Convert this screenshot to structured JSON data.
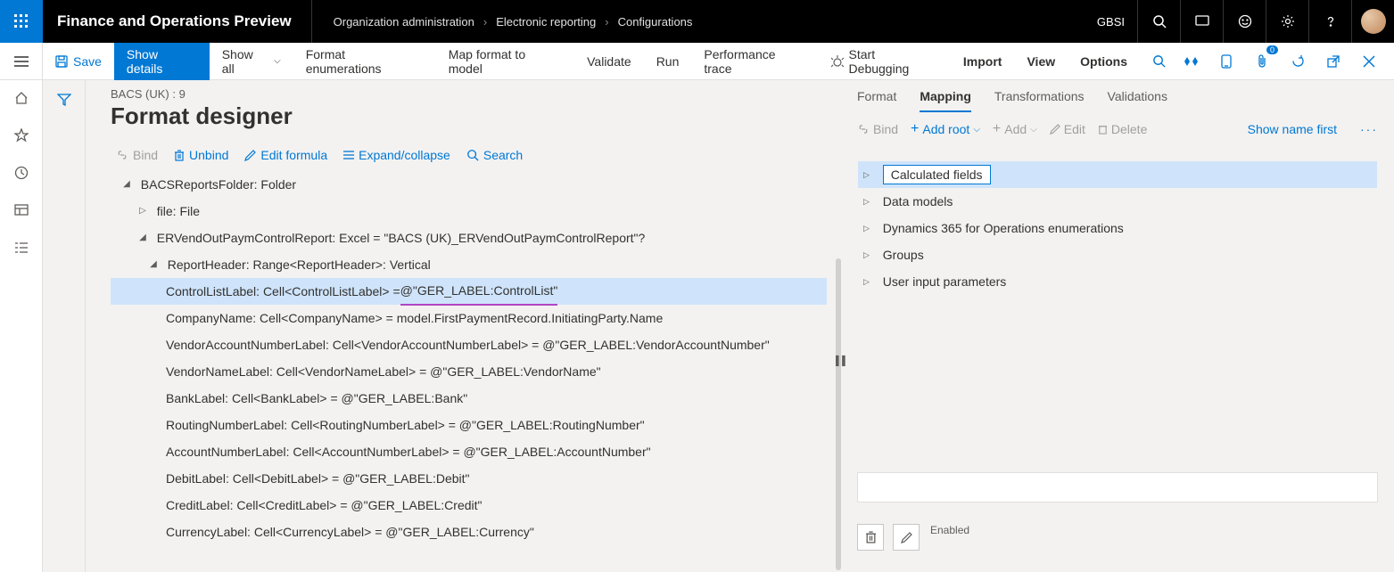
{
  "top": {
    "app_title": "Finance and Operations Preview",
    "crumb1": "Organization administration",
    "crumb2": "Electronic reporting",
    "crumb3": "Configurations",
    "company": "GBSI"
  },
  "cmd": {
    "save": "Save",
    "show_details": "Show details",
    "show_all": "Show all",
    "format_enum": "Format enumerations",
    "map_format": "Map format to model",
    "validate": "Validate",
    "run": "Run",
    "perf": "Performance trace",
    "debug": "Start Debugging",
    "import": "Import",
    "view": "View",
    "options": "Options",
    "badge": "0"
  },
  "page": {
    "subtitle": "BACS (UK) : 9",
    "title": "Format designer"
  },
  "tree_toolbar": {
    "bind": "Bind",
    "unbind": "Unbind",
    "edit_formula": "Edit formula",
    "expand": "Expand/collapse",
    "search": "Search"
  },
  "tree": {
    "root": "BACSReportsFolder: Folder",
    "file": "file: File",
    "excel": "ERVendOutPaymControlReport: Excel = \"BACS (UK)_ERVendOutPaymControlReport\"?",
    "header": "ReportHeader: Range<ReportHeader>: Vertical",
    "sel_lhs": "ControlListLabel: Cell<ControlListLabel> = ",
    "sel_rhs": "@\"GER_LABEL:ControlList\"",
    "r1": "CompanyName: Cell<CompanyName> = model.FirstPaymentRecord.InitiatingParty.Name",
    "r2": "VendorAccountNumberLabel: Cell<VendorAccountNumberLabel> = @\"GER_LABEL:VendorAccountNumber\"",
    "r3": "VendorNameLabel: Cell<VendorNameLabel> = @\"GER_LABEL:VendorName\"",
    "r4": "BankLabel: Cell<BankLabel> = @\"GER_LABEL:Bank\"",
    "r5": "RoutingNumberLabel: Cell<RoutingNumberLabel> = @\"GER_LABEL:RoutingNumber\"",
    "r6": "AccountNumberLabel: Cell<AccountNumberLabel> = @\"GER_LABEL:AccountNumber\"",
    "r7": "DebitLabel: Cell<DebitLabel> = @\"GER_LABEL:Debit\"",
    "r8": "CreditLabel: Cell<CreditLabel> = @\"GER_LABEL:Credit\"",
    "r9": "CurrencyLabel: Cell<CurrencyLabel> = @\"GER_LABEL:Currency\""
  },
  "tabs": {
    "format": "Format",
    "mapping": "Mapping",
    "transformations": "Transformations",
    "validations": "Validations"
  },
  "map_toolbar": {
    "bind": "Bind",
    "add_root": "Add root",
    "add": "Add",
    "edit": "Edit",
    "delete": "Delete",
    "show_name": "Show name first"
  },
  "ds": {
    "calc": "Calculated fields",
    "models": "Data models",
    "enum": "Dynamics 365 for Operations enumerations",
    "groups": "Groups",
    "user": "User input parameters"
  },
  "bottom": {
    "enabled": "Enabled"
  }
}
